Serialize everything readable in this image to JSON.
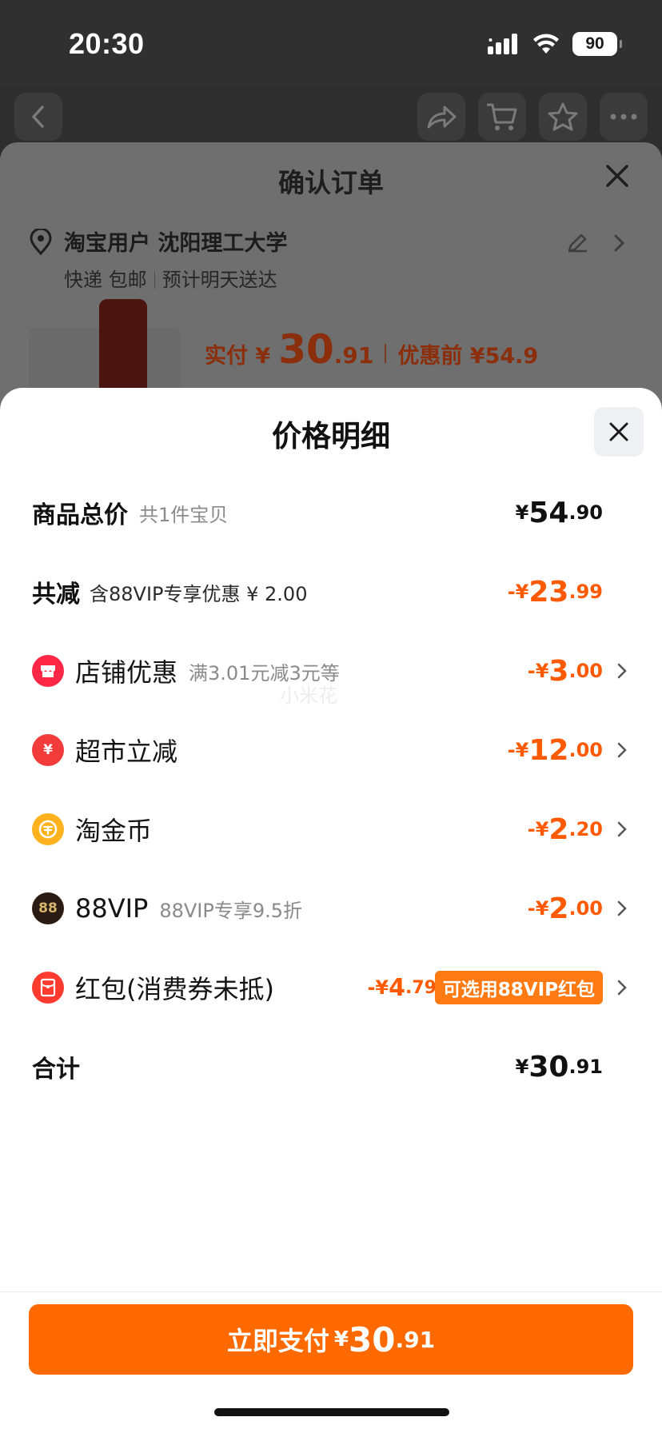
{
  "status_bar": {
    "time": "20:30",
    "battery": "90"
  },
  "order": {
    "title": "确认订单",
    "address_name": "淘宝用户 沈阳理工大学",
    "shipping": "快递 包邮",
    "delivery": "预计明天送达",
    "pay_label": "实付 ¥",
    "pay_int": "30",
    "pay_dec": ".91",
    "original": "优惠前 ¥54.9"
  },
  "detail": {
    "title": "价格明细",
    "watermark": "小米花",
    "rows": [
      {
        "title": "商品总价",
        "sub": "共1件宝贝",
        "cur": "¥",
        "int": "54",
        "dec": ".90"
      },
      {
        "title": "共减",
        "sub": "含88VIP专享优惠 ¥ 2.00",
        "cur": "-¥",
        "int": "23",
        "dec": ".99"
      },
      {
        "title": "店铺优惠",
        "sub": "满3.01元减3元等",
        "cur": "-¥",
        "int": "3",
        "dec": ".00",
        "icon": "store-icon"
      },
      {
        "title": "超市立减",
        "sub": "",
        "cur": "-¥",
        "int": "12",
        "dec": ".00",
        "icon": "yen-coin-icon"
      },
      {
        "title": "淘金币",
        "sub": "",
        "cur": "-¥",
        "int": "2",
        "dec": ".20",
        "icon": "gold-coin-icon"
      },
      {
        "title": "88VIP",
        "sub": "88VIP专享9.5折",
        "cur": "-¥",
        "int": "2",
        "dec": ".00",
        "icon": "vip-88-icon"
      },
      {
        "title": "红包(消费券未抵)",
        "sub": "",
        "cur": "-¥",
        "int": "4",
        "dec": ".79",
        "tag": "可选用88VIP红包",
        "icon": "red-packet-icon"
      },
      {
        "title": "合计",
        "sub": "",
        "cur": "¥",
        "int": "30",
        "dec": ".91"
      }
    ],
    "pay_button": {
      "label": "立即支付",
      "cur": "¥",
      "int": "30",
      "dec": ".91"
    }
  },
  "colors": {
    "accent": "#ff6a00",
    "discount": "#ff5a00"
  }
}
